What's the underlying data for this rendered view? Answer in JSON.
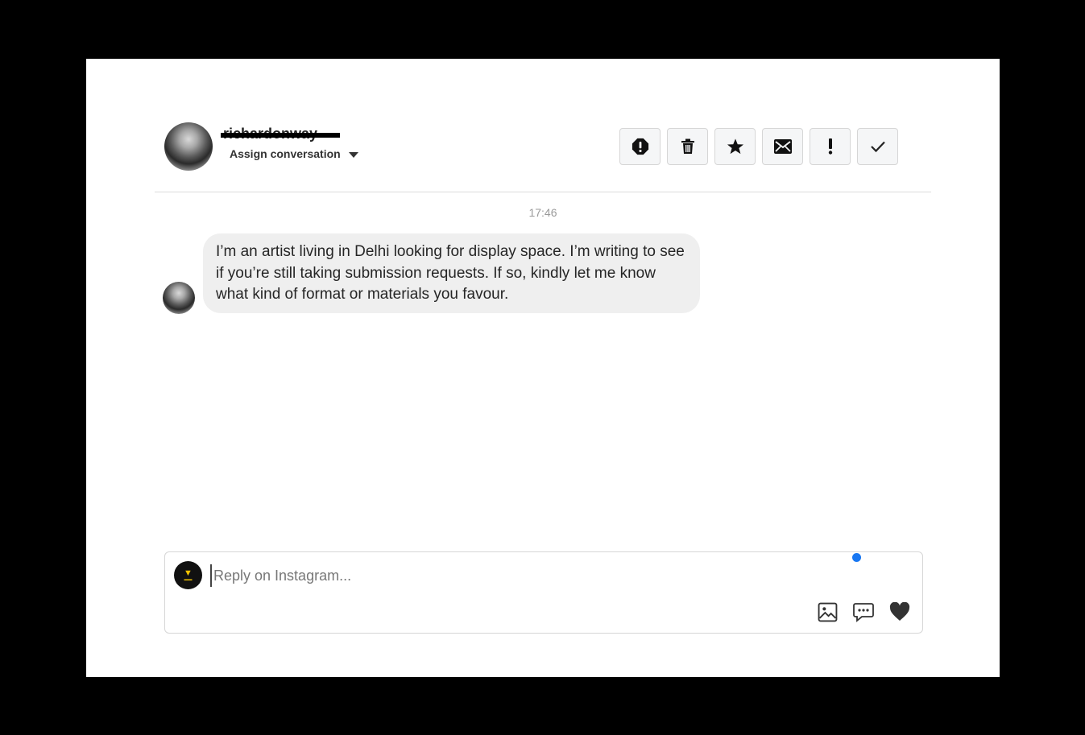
{
  "header": {
    "username": "richardonway",
    "assign_label": "Assign conversation",
    "actions": [
      {
        "name": "spam-button",
        "icon": "alert-octagon-icon"
      },
      {
        "name": "delete-button",
        "icon": "trash-icon"
      },
      {
        "name": "star-button",
        "icon": "star-icon"
      },
      {
        "name": "mark-unread-button",
        "icon": "envelope-icon"
      },
      {
        "name": "flag-button",
        "icon": "exclamation-icon"
      },
      {
        "name": "done-button",
        "icon": "checkmark-icon"
      }
    ]
  },
  "conversation": {
    "timestamp": "17:46",
    "messages": [
      {
        "text": "I’m an artist living in Delhi looking for display space. I’m writing to see if you’re still taking submission requests. If so, kindly let me know what kind of format or materials you favour."
      }
    ]
  },
  "composer": {
    "placeholder": "Reply on Instagram...",
    "tools": [
      "image-icon",
      "saved-replies-icon",
      "heart-icon"
    ]
  },
  "colors": {
    "accent_dot": "#1877f2",
    "bubble_bg": "#efefef"
  }
}
